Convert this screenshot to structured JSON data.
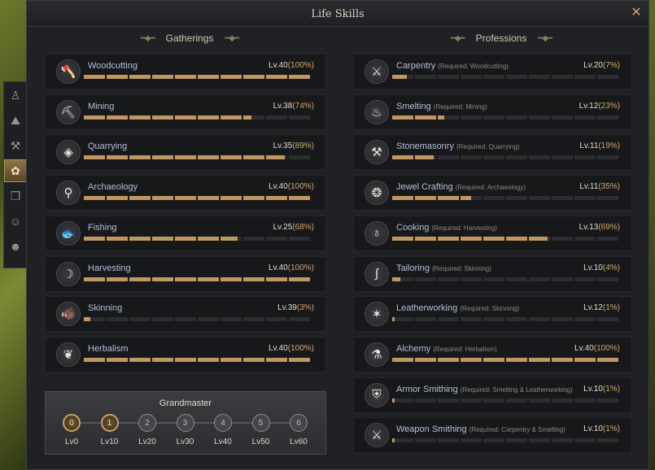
{
  "window": {
    "title": "Life Skills",
    "close_icon": "✕"
  },
  "side_tabs": [
    {
      "name": "character-icon",
      "glyph": "♙",
      "active": false
    },
    {
      "name": "map-icon",
      "glyph": "⛰",
      "active": false
    },
    {
      "name": "anvil-icon",
      "glyph": "⚒",
      "active": false
    },
    {
      "name": "life-skills-icon",
      "glyph": "✿",
      "active": true
    },
    {
      "name": "book-icon",
      "glyph": "❐",
      "active": false
    },
    {
      "name": "group-icon",
      "glyph": "☺",
      "active": false
    },
    {
      "name": "emote-icon",
      "glyph": "☻",
      "active": false
    }
  ],
  "gatherings": {
    "heading": "Gatherings",
    "skills": [
      {
        "name": "Woodcutting",
        "level": "Lv.40",
        "percent": "(100%)",
        "icon": "axe-icon",
        "glyph": "🪓",
        "fill": 1.0
      },
      {
        "name": "Mining",
        "level": "Lv.38",
        "percent": "(74%)",
        "icon": "pickaxe-icon",
        "glyph": "⛏",
        "fill": 0.74
      },
      {
        "name": "Quarrying",
        "level": "Lv.35",
        "percent": "(89%)",
        "icon": "stone-icon",
        "glyph": "◈",
        "fill": 0.89
      },
      {
        "name": "Archaeology",
        "level": "Lv.40",
        "percent": "(100%)",
        "icon": "shovel-icon",
        "glyph": "⚲",
        "fill": 1.0
      },
      {
        "name": "Fishing",
        "level": "Lv.25",
        "percent": "(68%)",
        "icon": "fish-icon",
        "glyph": "🐟",
        "fill": 0.68
      },
      {
        "name": "Harvesting",
        "level": "Lv.40",
        "percent": "(100%)",
        "icon": "sickle-icon",
        "glyph": "☽",
        "fill": 1.0
      },
      {
        "name": "Skinning",
        "level": "Lv.39",
        "percent": "(3%)",
        "icon": "boar-icon",
        "glyph": "🐗",
        "fill": 0.03
      },
      {
        "name": "Herbalism",
        "level": "Lv.40",
        "percent": "(100%)",
        "icon": "leaf-icon",
        "glyph": "❦",
        "fill": 1.0
      }
    ]
  },
  "professions": {
    "heading": "Professions",
    "skills": [
      {
        "name": "Carpentry",
        "req": "(Required: Woodcutting)",
        "level": "Lv.20",
        "percent": "(7%)",
        "icon": "saw-icon",
        "glyph": "⚔",
        "fill": 0.07
      },
      {
        "name": "Smelting",
        "req": "(Required: Mining)",
        "level": "Lv.12",
        "percent": "(23%)",
        "icon": "furnace-icon",
        "glyph": "♨",
        "fill": 0.23
      },
      {
        "name": "Stonemasonry",
        "req": "(Required: Quarrying)",
        "level": "Lv.11",
        "percent": "(19%)",
        "icon": "hammer-icon",
        "glyph": "⚒",
        "fill": 0.19
      },
      {
        "name": "Jewel Crafting",
        "req": "(Required: Archaeology)",
        "level": "Lv.11",
        "percent": "(35%)",
        "icon": "gem-icon",
        "glyph": "❂",
        "fill": 0.35
      },
      {
        "name": "Cooking",
        "req": "(Required: Harvesting)",
        "level": "Lv.13",
        "percent": "(69%)",
        "icon": "pot-icon",
        "glyph": "♁",
        "fill": 0.69
      },
      {
        "name": "Tailoring",
        "req": "(Required: Skinning)",
        "level": "Lv.10",
        "percent": "(4%)",
        "icon": "needle-icon",
        "glyph": "∫",
        "fill": 0.04
      },
      {
        "name": "Leatherworking",
        "req": "(Required: Skinning)",
        "level": "Lv.12",
        "percent": "(1%)",
        "icon": "hide-icon",
        "glyph": "✶",
        "fill": 0.01
      },
      {
        "name": "Alchemy",
        "req": "(Required: Herbalism)",
        "level": "Lv.40",
        "percent": "(100%)",
        "icon": "mortar-icon",
        "glyph": "⚗",
        "fill": 1.0
      },
      {
        "name": "Armor Smithing",
        "req": "(Required: Smelting & Leatherworking)",
        "level": "Lv.10",
        "percent": "(1%)",
        "icon": "armor-icon",
        "glyph": "⛨",
        "fill": 0.01
      },
      {
        "name": "Weapon Smithing",
        "req": "(Required: Carpentry & Smelting)",
        "level": "Lv.10",
        "percent": "(1%)",
        "icon": "gun-icon",
        "glyph": "⚔",
        "fill": 0.01
      }
    ]
  },
  "grandmaster": {
    "title": "Grandmaster",
    "nodes": [
      {
        "number": "0",
        "label": "Lv0",
        "done": true
      },
      {
        "number": "1",
        "label": "Lv10",
        "done": true
      },
      {
        "number": "2",
        "label": "Lv20",
        "done": false
      },
      {
        "number": "3",
        "label": "Lv30",
        "done": false
      },
      {
        "number": "4",
        "label": "Lv40",
        "done": false
      },
      {
        "number": "5",
        "label": "Lv50",
        "done": false
      },
      {
        "number": "6",
        "label": "Lv60",
        "done": false
      }
    ]
  }
}
